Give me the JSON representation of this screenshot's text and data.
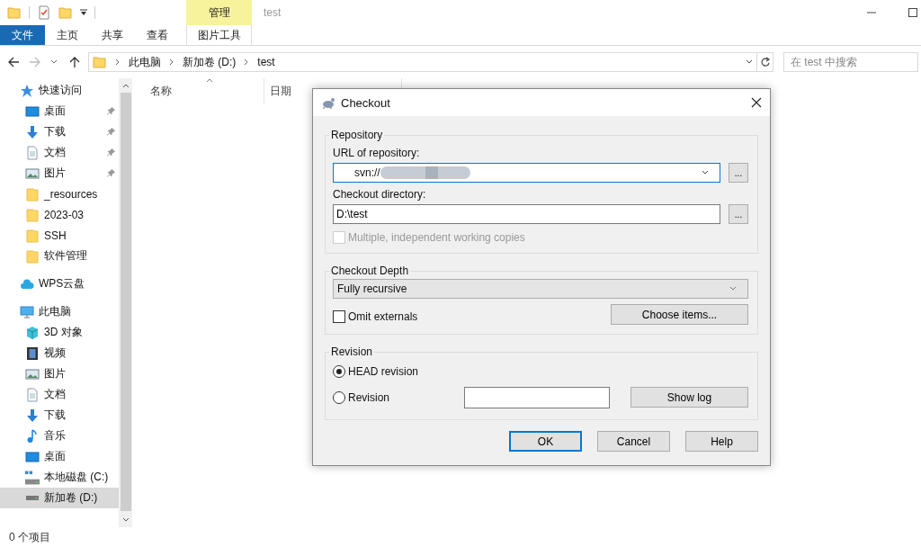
{
  "title_bar": {
    "context_tab": "管理",
    "title": "test"
  },
  "ribbon_tabs": [
    {
      "label": "文件",
      "kind": "file"
    },
    {
      "label": "主页",
      "kind": "tab"
    },
    {
      "label": "共享",
      "kind": "tab"
    },
    {
      "label": "查看",
      "kind": "tab"
    },
    {
      "label": "图片工具",
      "kind": "context"
    }
  ],
  "address": {
    "crumbs": [
      "此电脑",
      "新加卷 (D:)",
      "test"
    ]
  },
  "search": {
    "placeholder": "在 test 中搜索"
  },
  "nav": [
    {
      "label": "快速访问",
      "kind": "star",
      "selected": false,
      "children": [
        {
          "label": "桌面",
          "kind": "desktop",
          "pinned": true,
          "selected": false
        },
        {
          "label": "下载",
          "kind": "download",
          "pinned": true,
          "selected": false
        },
        {
          "label": "文档",
          "kind": "document",
          "pinned": true,
          "selected": false
        },
        {
          "label": "图片",
          "kind": "picture",
          "pinned": true,
          "selected": false
        },
        {
          "label": "_resources",
          "kind": "folder",
          "pinned": false,
          "selected": false
        },
        {
          "label": "2023-03",
          "kind": "folder",
          "pinned": false,
          "selected": false
        },
        {
          "label": "SSH",
          "kind": "folder",
          "pinned": false,
          "selected": false
        },
        {
          "label": "软件管理",
          "kind": "folder",
          "pinned": false,
          "selected": false
        }
      ]
    },
    {
      "label": "WPS云盘",
      "kind": "cloud",
      "selected": false
    },
    {
      "label": "此电脑",
      "kind": "computer",
      "selected": false,
      "children": [
        {
          "label": "3D 对象",
          "kind": "cube",
          "pinned": false,
          "selected": false
        },
        {
          "label": "视频",
          "kind": "video",
          "pinned": false,
          "selected": false
        },
        {
          "label": "图片",
          "kind": "picture",
          "pinned": false,
          "selected": false
        },
        {
          "label": "文档",
          "kind": "document",
          "pinned": false,
          "selected": false
        },
        {
          "label": "下载",
          "kind": "download",
          "pinned": false,
          "selected": false
        },
        {
          "label": "音乐",
          "kind": "music",
          "pinned": false,
          "selected": false
        },
        {
          "label": "桌面",
          "kind": "desktop",
          "pinned": false,
          "selected": false
        },
        {
          "label": "本地磁盘 (C:)",
          "kind": "systemdisk",
          "pinned": false,
          "selected": false
        },
        {
          "label": "新加卷 (D:)",
          "kind": "disk",
          "pinned": false,
          "selected": true
        }
      ]
    }
  ],
  "columns": [
    "名称",
    "日期"
  ],
  "status_bar": "0 个项目",
  "dialog": {
    "title": "Checkout",
    "repository": {
      "legend": "Repository",
      "url_label": "URL of repository:",
      "url_value": "svn://",
      "url_browse": "...",
      "dir_label": "Checkout directory:",
      "dir_value": "D:\\test",
      "dir_browse": "...",
      "multiple": {
        "label": "Multiple, independent working copies",
        "checked": false,
        "disabled": true
      }
    },
    "depth": {
      "legend": "Checkout Depth",
      "value": "Fully recursive",
      "omit": {
        "label": "Omit externals",
        "checked": false
      },
      "choose": "Choose items..."
    },
    "revision": {
      "legend": "Revision",
      "options": [
        {
          "label": "HEAD revision",
          "selected": true
        },
        {
          "label": "Revision",
          "selected": false
        }
      ],
      "show_log": "Show log"
    },
    "buttons": [
      {
        "label": "OK",
        "kind": "default"
      },
      {
        "label": "Cancel",
        "kind": "normal"
      },
      {
        "label": "Help",
        "kind": "normal"
      }
    ]
  }
}
